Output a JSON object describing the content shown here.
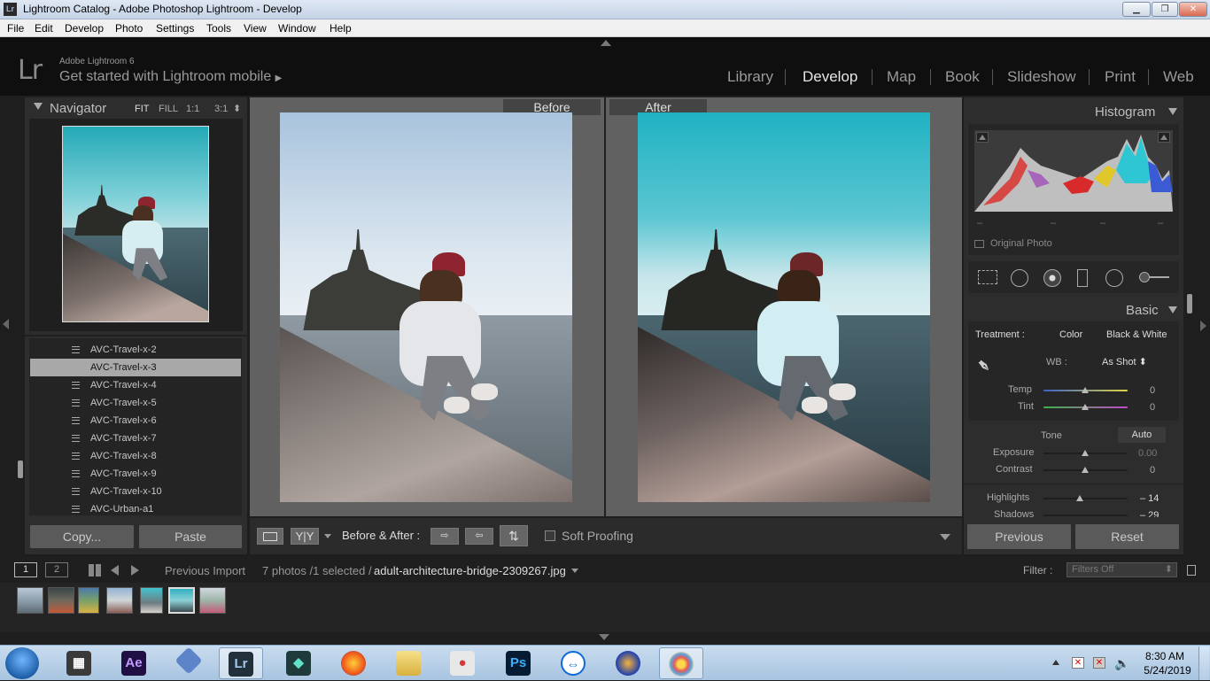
{
  "window": {
    "title": "Lightroom Catalog - Adobe Photoshop Lightroom - Develop",
    "logo": "Lr",
    "min": "▁",
    "max": "❐",
    "close": "✕"
  },
  "menu": [
    "File",
    "Edit",
    "Develop",
    "Photo",
    "Settings",
    "Tools",
    "View",
    "Window",
    "Help"
  ],
  "identity": {
    "logo": "Lr",
    "brand": "Adobe Lightroom 6",
    "mobile": "Get started with Lightroom mobile",
    "arrow": "▶"
  },
  "modules": [
    {
      "label": "Library",
      "active": false
    },
    {
      "label": "Develop",
      "active": true
    },
    {
      "label": "Map",
      "active": false
    },
    {
      "label": "Book",
      "active": false
    },
    {
      "label": "Slideshow",
      "active": false
    },
    {
      "label": "Print",
      "active": false
    },
    {
      "label": "Web",
      "active": false
    }
  ],
  "navigator": {
    "title": "Navigator",
    "fit": "FIT",
    "fill": "FILL",
    "z1": "1:1",
    "z3": "3:1",
    "arrows": "⬍"
  },
  "files": [
    "AVC-Travel-x-2",
    "AVC-Travel-x-3",
    "AVC-Travel-x-4",
    "AVC-Travel-x-5",
    "AVC-Travel-x-6",
    "AVC-Travel-x-7",
    "AVC-Travel-x-8",
    "AVC-Travel-x-9",
    "AVC-Travel-x-10",
    "AVC-Urban-a1"
  ],
  "selected_file": "AVC-Travel-x-3",
  "left_buttons": {
    "copy": "Copy...",
    "paste": "Paste"
  },
  "view": {
    "before": "Before",
    "after": "After"
  },
  "toolbar": {
    "yy": "Y|Y",
    "label": "Before & After :",
    "soft_proofing": "Soft Proofing"
  },
  "histogram": {
    "title": "Histogram",
    "original_photo": "Original Photo",
    "ticks": [
      "–",
      "–",
      "–",
      "–"
    ]
  },
  "basic": {
    "title": "Basic",
    "treatment_label": "Treatment :",
    "treatment_color": "Color",
    "treatment_bw": "Black & White",
    "wb_label": "WB :",
    "wb_value": "As Shot",
    "temp": {
      "label": "Temp",
      "value": "0"
    },
    "tint": {
      "label": "Tint",
      "value": "0"
    },
    "tone_label": "Tone",
    "auto": "Auto",
    "exposure": {
      "label": "Exposure",
      "value": "0.00"
    },
    "contrast": {
      "label": "Contrast",
      "value": "0"
    },
    "highlights": {
      "label": "Highlights",
      "value": "– 14"
    },
    "shadows": {
      "label": "Shadows",
      "value": "– 29"
    }
  },
  "right_buttons": {
    "previous": "Previous",
    "reset": "Reset"
  },
  "filmbar": {
    "page1": "1",
    "page2": "2",
    "source": "Previous Import",
    "count": "7 photos /1 selected /",
    "filename": "adult-architecture-bridge-2309267.jpg",
    "filter_label": "Filter :",
    "filter_value": "Filters Off"
  },
  "taskbar": {
    "time": "8:30 AM",
    "date": "5/24/2019"
  },
  "taskbar_apps": [
    "windows-start",
    "media-player",
    "after-effects",
    "app-diamond",
    "lightroom",
    "filmora",
    "firefox",
    "file-explorer",
    "camera-app",
    "photoshop",
    "teamviewer",
    "audio-headphones",
    "paint"
  ],
  "colors": {
    "accent_teal": "#3fb7c6",
    "hat": "#8e2430",
    "lr_bg": "#1e1e1e"
  }
}
